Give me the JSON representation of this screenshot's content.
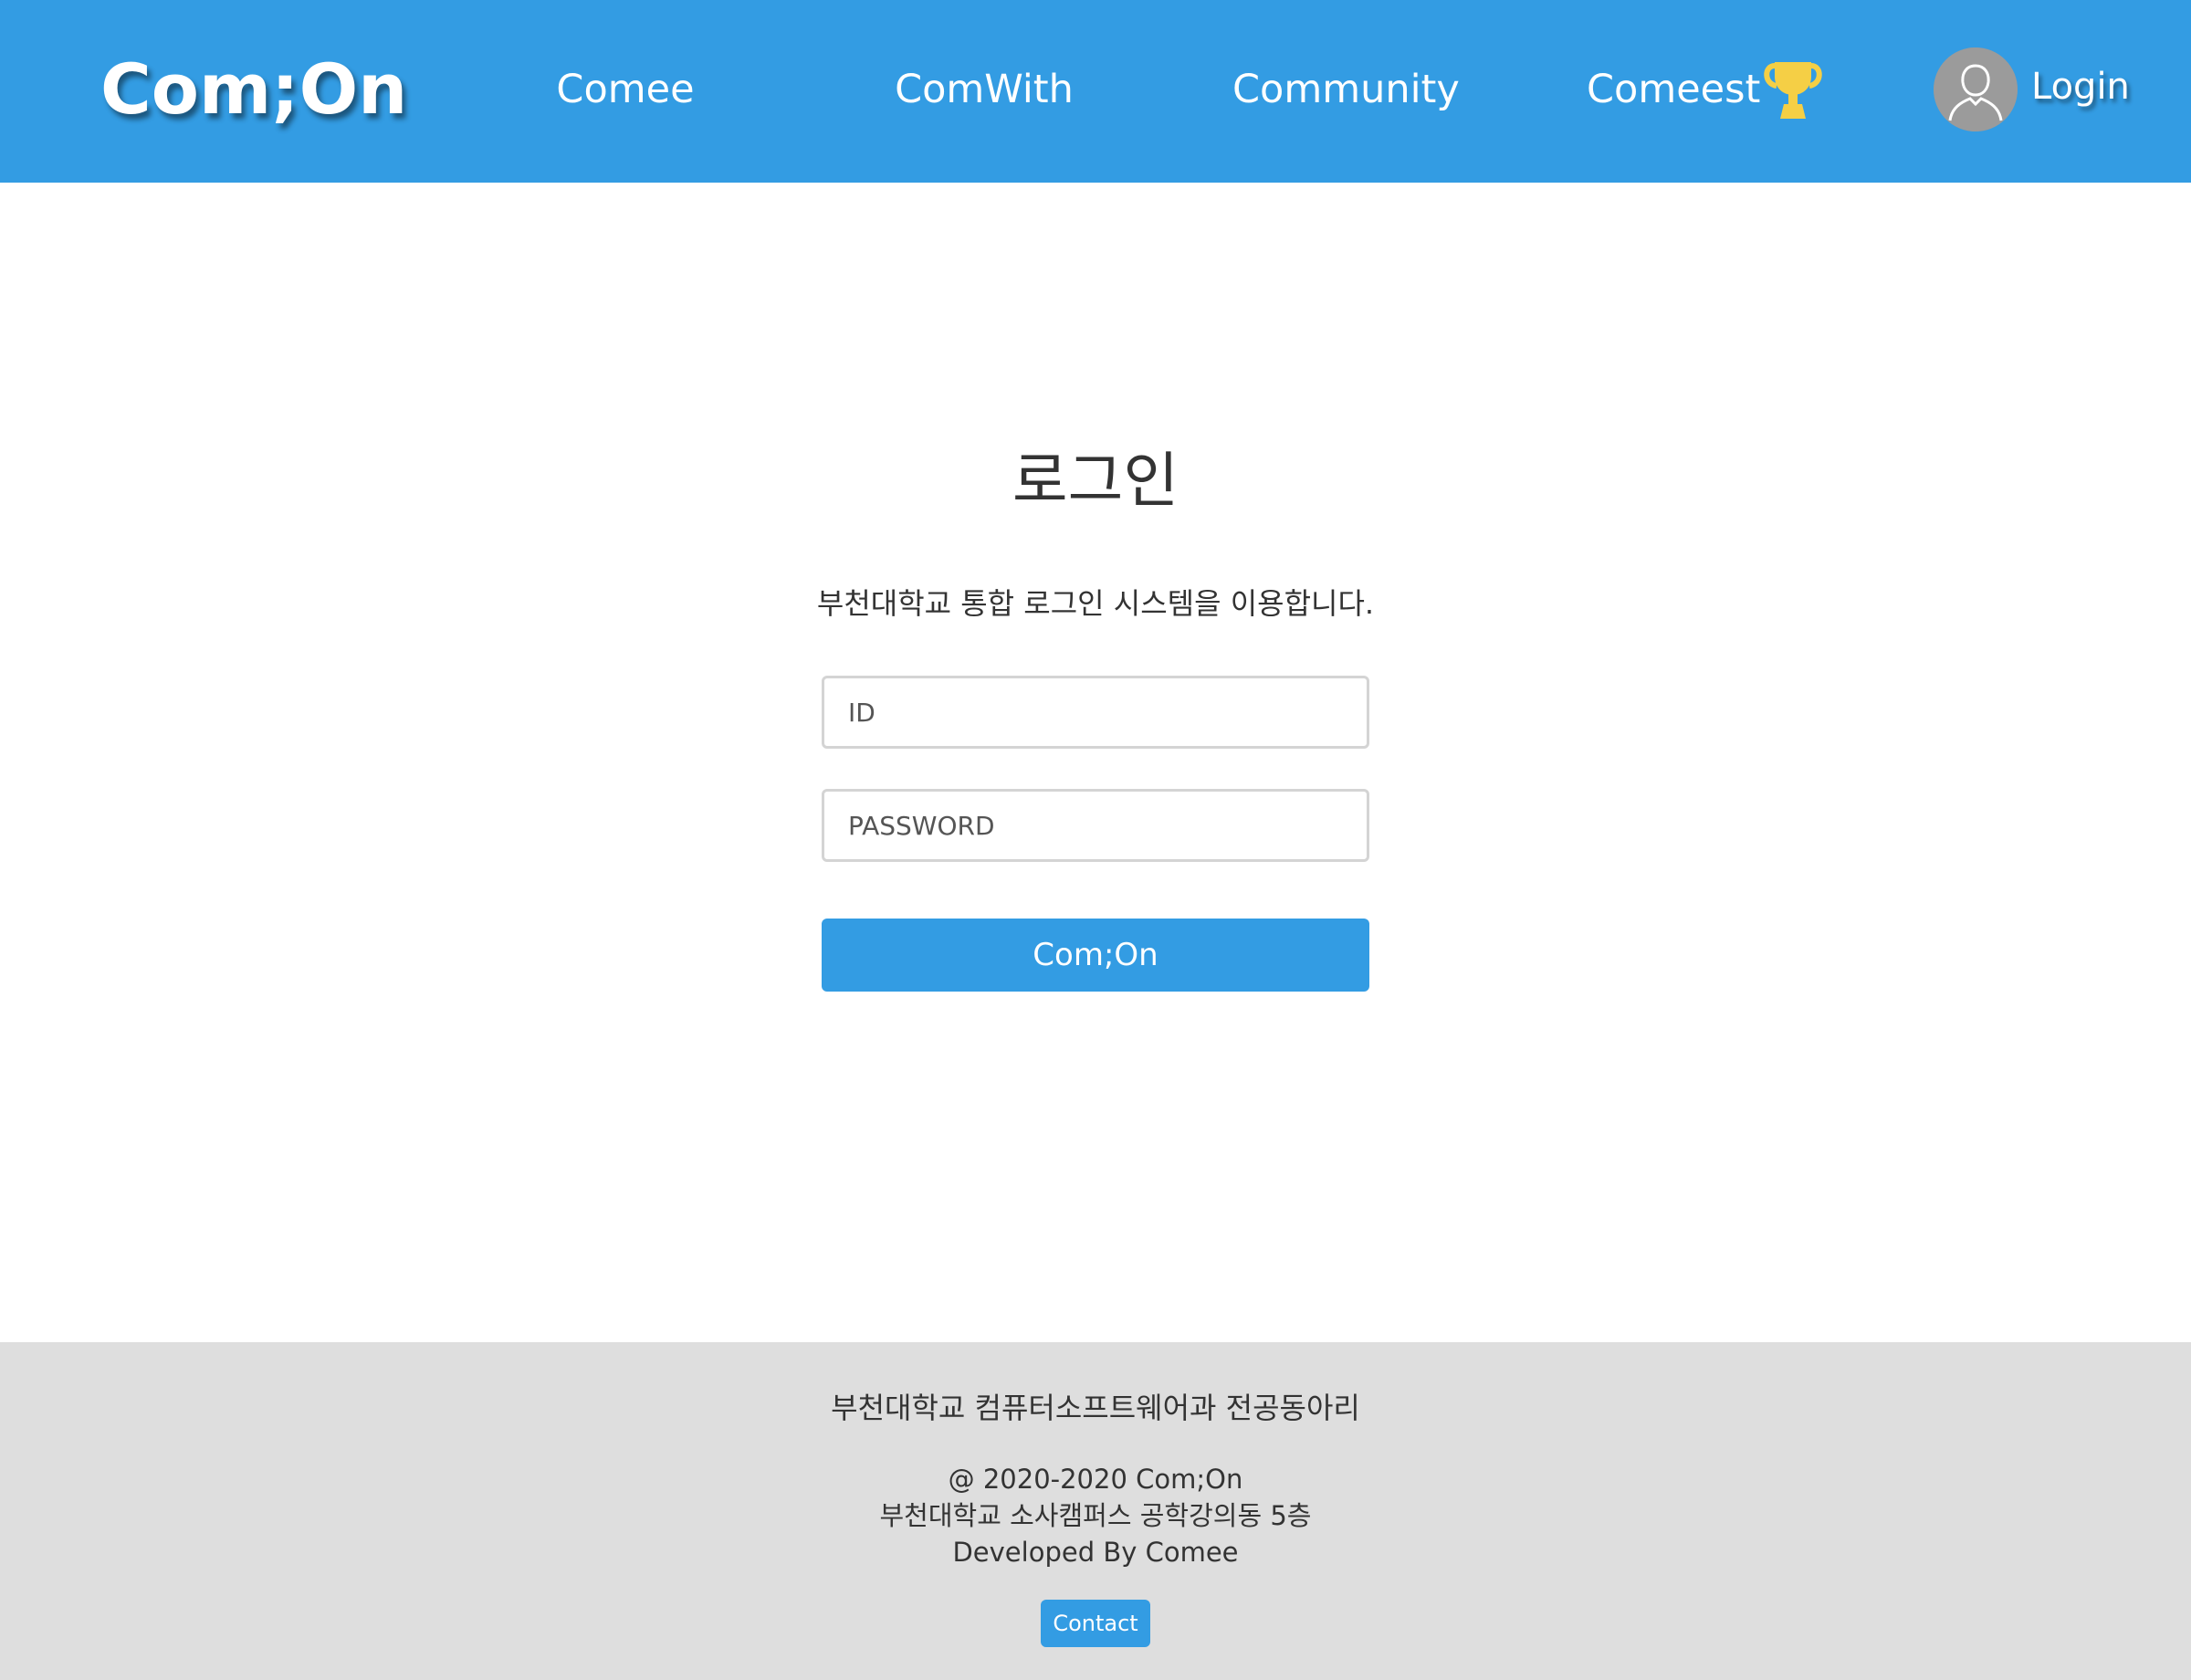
{
  "header": {
    "brand": "Com;On",
    "nav": {
      "comee": "Comee",
      "comwith": "ComWith",
      "community": "Community",
      "comeest": "Comeest"
    },
    "trophy_icon": "trophy-icon",
    "avatar_icon": "user-avatar-icon",
    "login_label": "Login"
  },
  "login": {
    "title": "로그인",
    "description": "부천대학교 통합 로그인 시스템을 이용합니다.",
    "id_placeholder": "ID",
    "password_placeholder": "PASSWORD",
    "submit_label": "Com;On"
  },
  "footer": {
    "title": "부천대학교 컴퓨터소프트웨어과 전공동아리",
    "copyright": "@ 2020-2020 Com;On",
    "address": "부천대학교 소사캠퍼스 공학강의동 5층",
    "developer": "Developed By Comee",
    "contact_label": "Contact"
  },
  "colors": {
    "primary": "#339ce3",
    "trophy": "#f5cf45",
    "footer_bg": "#dedede",
    "avatar_bg": "#9b9b9b"
  }
}
